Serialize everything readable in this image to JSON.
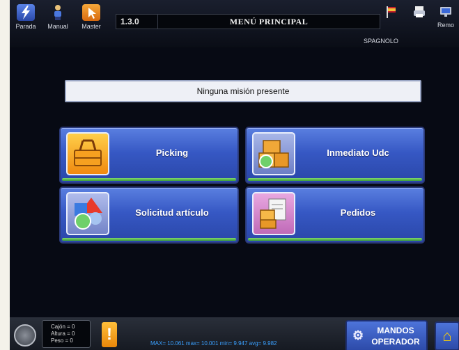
{
  "header": {
    "version": "1.3.0",
    "title": "MENÚ PRINCIPAL",
    "language": "SPAGNOLO",
    "buttons": [
      {
        "label": "Parada",
        "icon": "lightning-icon"
      },
      {
        "label": "Manual",
        "icon": "person-icon"
      },
      {
        "label": "Master",
        "icon": "cursor-icon"
      }
    ],
    "remote_label": "Remo"
  },
  "mission": {
    "status": "Ninguna misión presente"
  },
  "menu": [
    {
      "label": "Picking",
      "icon": "basket-icon"
    },
    {
      "label": "Inmediato Udc",
      "icon": "boxes-icon"
    },
    {
      "label": "Solicitud artículo",
      "icon": "shapes-icon"
    },
    {
      "label": "Pedidos",
      "icon": "documents-icon"
    }
  ],
  "footer": {
    "cajon": "Cajón = 0",
    "altura": "Altura = 0",
    "peso": "Peso = 0",
    "warning": "!",
    "measurements": "MAX= 10.061 max= 10.001  min= 9.947  avg= 9.982",
    "mandos_line1": "MANDOS",
    "mandos_line2": "OPERADOR"
  },
  "colors": {
    "accent": "#3658c4",
    "bar": "#3e9c3a",
    "warning": "#e8860a"
  }
}
